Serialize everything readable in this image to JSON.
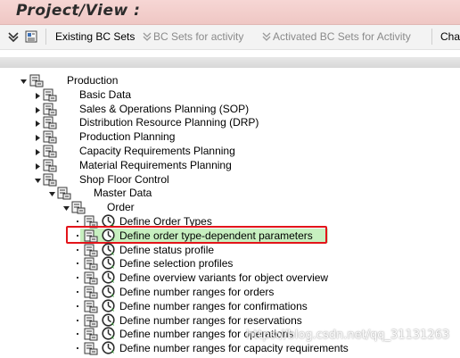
{
  "window": {
    "title": "Project/View  :"
  },
  "toolbar": {
    "existing_bc_sets": "Existing BC Sets",
    "bc_sets_for_activity": "BC Sets for activity",
    "activated_bc_sets": "Activated BC Sets for Activity",
    "change_log_truncated": "Cha"
  },
  "tree": {
    "production": "Production",
    "basic_data": "Basic Data",
    "sop": "Sales & Operations Planning (SOP)",
    "drp": "Distribution Resource Planning (DRP)",
    "production_planning": "Production Planning",
    "capacity_requirements_planning": "Capacity Requirements Planning",
    "material_requirements_planning": "Material Requirements Planning",
    "shop_floor_control": "Shop Floor Control",
    "master_data": "Master Data",
    "order": "Order",
    "activities": [
      "Define Order Types",
      "Define order type-dependent parameters",
      "Define status profile",
      "Define selection profiles",
      "Define overview variants for object overview",
      "Define number ranges for orders",
      "Define number ranges for confirmations",
      "Define number ranges for reservations",
      "Define number ranges for operations",
      "Define number ranges for capacity requirements"
    ],
    "selected_activity_index": 1
  },
  "watermark": "https://blog.csdn.net/qq_31131263",
  "colors": {
    "title_bar": "#efc7c4",
    "selection_fill": "#c7f0c0",
    "highlight_box": "#e3141a"
  }
}
